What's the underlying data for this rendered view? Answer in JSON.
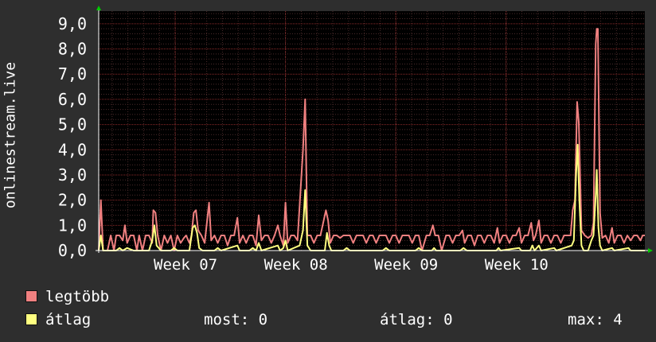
{
  "chart_data": {
    "type": "line",
    "ylabel": "onlinestream.live",
    "ylim": [
      0,
      9.5
    ],
    "yticks": [
      0,
      1,
      2,
      3,
      4,
      5,
      6,
      7,
      8,
      9
    ],
    "ytick_labels": [
      "0,0",
      "1,0",
      "2,0",
      "3,0",
      "4,0",
      "5,0",
      "6,0",
      "7,0",
      "8,0",
      "9,0"
    ],
    "xlim": [
      0,
      100
    ],
    "xticks": [
      {
        "x": 14,
        "label": "Week 07"
      },
      {
        "x": 34.2,
        "label": "Week 08"
      },
      {
        "x": 54.4,
        "label": "Week 09"
      },
      {
        "x": 74.6,
        "label": "Week 10"
      }
    ],
    "grid": true,
    "series": [
      {
        "name": "legtöbb",
        "color": "#f08080",
        "points": [
          [
            0,
            0
          ],
          [
            0.4,
            2.0
          ],
          [
            0.8,
            0
          ],
          [
            1.6,
            0
          ],
          [
            2.2,
            0.6
          ],
          [
            2.8,
            0
          ],
          [
            3.2,
            0.6
          ],
          [
            3.8,
            0.6
          ],
          [
            4.4,
            0.4
          ],
          [
            4.8,
            1.0
          ],
          [
            5.2,
            0.3
          ],
          [
            5.8,
            0.6
          ],
          [
            6.4,
            0.6
          ],
          [
            7.0,
            0
          ],
          [
            7.4,
            0.6
          ],
          [
            8.0,
            0
          ],
          [
            8.6,
            0.6
          ],
          [
            9.2,
            0.6
          ],
          [
            9.8,
            0.3
          ],
          [
            10.0,
            1.6
          ],
          [
            10.4,
            1.5
          ],
          [
            10.8,
            0.6
          ],
          [
            11.4,
            0
          ],
          [
            12.0,
            0.6
          ],
          [
            12.6,
            0.3
          ],
          [
            13.2,
            0.6
          ],
          [
            13.8,
            0
          ],
          [
            14.4,
            0.6
          ],
          [
            15.0,
            0.3
          ],
          [
            15.6,
            0.5
          ],
          [
            16.0,
            0.6
          ],
          [
            16.6,
            0.3
          ],
          [
            17.0,
            0.6
          ],
          [
            17.4,
            1.5
          ],
          [
            17.8,
            1.6
          ],
          [
            18.2,
            0.8
          ],
          [
            18.8,
            0.6
          ],
          [
            19.4,
            0.3
          ],
          [
            20.2,
            1.9
          ],
          [
            20.6,
            0.4
          ],
          [
            21.2,
            0.6
          ],
          [
            21.8,
            0.3
          ],
          [
            22.4,
            0.6
          ],
          [
            23.0,
            0.6
          ],
          [
            23.6,
            0.2
          ],
          [
            24.2,
            0.6
          ],
          [
            24.8,
            0.6
          ],
          [
            25.4,
            1.3
          ],
          [
            25.8,
            0.3
          ],
          [
            26.4,
            0.6
          ],
          [
            27.0,
            0.3
          ],
          [
            27.6,
            0.6
          ],
          [
            28.2,
            0.6
          ],
          [
            28.8,
            0.2
          ],
          [
            29.3,
            1.4
          ],
          [
            29.8,
            0.4
          ],
          [
            30.4,
            0.6
          ],
          [
            31.0,
            0.6
          ],
          [
            31.6,
            0.3
          ],
          [
            32.2,
            0.6
          ],
          [
            32.8,
            1.0
          ],
          [
            33.2,
            0.6
          ],
          [
            33.8,
            0.2
          ],
          [
            34.2,
            1.9
          ],
          [
            34.6,
            0.3
          ],
          [
            35.2,
            0.6
          ],
          [
            35.8,
            0.6
          ],
          [
            36.4,
            0.4
          ],
          [
            37.4,
            4.0
          ],
          [
            37.8,
            6.0
          ],
          [
            38.2,
            0.6
          ],
          [
            38.8,
            0.6
          ],
          [
            39.4,
            0.3
          ],
          [
            40.0,
            0.6
          ],
          [
            40.6,
            0.6
          ],
          [
            41.6,
            1.6
          ],
          [
            42.0,
            1.2
          ],
          [
            42.4,
            0.3
          ],
          [
            43.0,
            0.6
          ],
          [
            43.6,
            0.6
          ],
          [
            44.2,
            0.5
          ],
          [
            44.8,
            0.6
          ],
          [
            45.4,
            0.6
          ],
          [
            46.0,
            0.6
          ],
          [
            46.6,
            0.3
          ],
          [
            47.2,
            0.6
          ],
          [
            47.8,
            0.6
          ],
          [
            48.4,
            0.6
          ],
          [
            49.0,
            0.3
          ],
          [
            49.6,
            0.6
          ],
          [
            50.2,
            0.6
          ],
          [
            50.8,
            0.3
          ],
          [
            51.4,
            0.6
          ],
          [
            52.0,
            0.6
          ],
          [
            52.6,
            0.6
          ],
          [
            53.2,
            0.3
          ],
          [
            53.8,
            0.6
          ],
          [
            54.4,
            0.6
          ],
          [
            55.0,
            0.3
          ],
          [
            55.6,
            0.6
          ],
          [
            56.2,
            0.6
          ],
          [
            56.8,
            0.6
          ],
          [
            57.4,
            0.3
          ],
          [
            58.0,
            0.6
          ],
          [
            58.6,
            0.6
          ],
          [
            59.2,
            0
          ],
          [
            60.0,
            0.6
          ],
          [
            60.6,
            0.6
          ],
          [
            61.2,
            1.0
          ],
          [
            61.6,
            0.6
          ],
          [
            62.2,
            0.6
          ],
          [
            62.8,
            0
          ],
          [
            63.6,
            0.6
          ],
          [
            64.2,
            0.6
          ],
          [
            64.8,
            0.3
          ],
          [
            65.4,
            0.6
          ],
          [
            66.0,
            0.6
          ],
          [
            66.6,
            0.8
          ],
          [
            67.0,
            0.3
          ],
          [
            67.6,
            0.6
          ],
          [
            68.2,
            0.6
          ],
          [
            68.8,
            0.2
          ],
          [
            69.4,
            0.6
          ],
          [
            70.0,
            0.6
          ],
          [
            70.6,
            0.3
          ],
          [
            71.2,
            0.6
          ],
          [
            71.8,
            0.6
          ],
          [
            72.4,
            0.3
          ],
          [
            73.0,
            0.9
          ],
          [
            73.4,
            0.3
          ],
          [
            74.0,
            0.6
          ],
          [
            74.6,
            0.6
          ],
          [
            75.2,
            0.3
          ],
          [
            75.8,
            0.6
          ],
          [
            76.4,
            0.6
          ],
          [
            77.0,
            0.9
          ],
          [
            77.4,
            0.3
          ],
          [
            78.0,
            0.6
          ],
          [
            78.6,
            0.6
          ],
          [
            79.2,
            1.1
          ],
          [
            79.6,
            0.4
          ],
          [
            80.0,
            0.6
          ],
          [
            80.6,
            1.2
          ],
          [
            81.0,
            0.3
          ],
          [
            81.6,
            0.6
          ],
          [
            82.2,
            0.6
          ],
          [
            82.8,
            0.3
          ],
          [
            83.4,
            0.6
          ],
          [
            84.0,
            0.6
          ],
          [
            84.6,
            0.3
          ],
          [
            85.2,
            0.6
          ],
          [
            85.8,
            0.6
          ],
          [
            86.4,
            0.6
          ],
          [
            86.8,
            1.6
          ],
          [
            87.2,
            2.0
          ],
          [
            87.6,
            5.9
          ],
          [
            87.9,
            5.1
          ],
          [
            88.4,
            0.8
          ],
          [
            89.0,
            0.6
          ],
          [
            89.6,
            0.5
          ],
          [
            90.2,
            0.6
          ],
          [
            90.6,
            1.1
          ],
          [
            91.0,
            8.2
          ],
          [
            91.2,
            8.8
          ],
          [
            91.4,
            8.8
          ],
          [
            91.8,
            1.5
          ],
          [
            92.2,
            0.5
          ],
          [
            92.8,
            0.6
          ],
          [
            93.4,
            0.3
          ],
          [
            94.0,
            0.9
          ],
          [
            94.4,
            0.3
          ],
          [
            95.0,
            0.6
          ],
          [
            95.6,
            0.6
          ],
          [
            96.2,
            0.3
          ],
          [
            96.8,
            0.6
          ],
          [
            97.4,
            0.4
          ],
          [
            98.0,
            0.6
          ],
          [
            98.6,
            0.6
          ],
          [
            99.2,
            0.4
          ],
          [
            99.6,
            0.6
          ],
          [
            100,
            0.6
          ]
        ]
      },
      {
        "name": "átlag",
        "color": "#ffff80",
        "points": [
          [
            0,
            0
          ],
          [
            0.4,
            0.6
          ],
          [
            0.8,
            0
          ],
          [
            3.2,
            0
          ],
          [
            3.8,
            0.1
          ],
          [
            4.4,
            0
          ],
          [
            5.2,
            0.1
          ],
          [
            6.4,
            0
          ],
          [
            9.2,
            0
          ],
          [
            9.8,
            0.4
          ],
          [
            10.2,
            1.0
          ],
          [
            10.6,
            0.2
          ],
          [
            11.4,
            0
          ],
          [
            13.2,
            0
          ],
          [
            13.8,
            0.1
          ],
          [
            14.4,
            0
          ],
          [
            16.6,
            0
          ],
          [
            17.2,
            0.9
          ],
          [
            17.6,
            1.0
          ],
          [
            18.0,
            0.7
          ],
          [
            18.4,
            0.1
          ],
          [
            19.0,
            0
          ],
          [
            21.2,
            0
          ],
          [
            21.8,
            0.1
          ],
          [
            22.4,
            0
          ],
          [
            25.4,
            0.2
          ],
          [
            25.8,
            0
          ],
          [
            27.6,
            0
          ],
          [
            28.2,
            0.1
          ],
          [
            28.8,
            0
          ],
          [
            29.3,
            0.3
          ],
          [
            29.8,
            0
          ],
          [
            32.8,
            0.2
          ],
          [
            33.2,
            0
          ],
          [
            33.8,
            0.1
          ],
          [
            34.2,
            0.4
          ],
          [
            34.6,
            0
          ],
          [
            36.8,
            0.2
          ],
          [
            37.4,
            0.8
          ],
          [
            37.8,
            2.4
          ],
          [
            38.2,
            0.2
          ],
          [
            38.8,
            0
          ],
          [
            41.4,
            0
          ],
          [
            41.8,
            0.7
          ],
          [
            42.2,
            0.2
          ],
          [
            42.6,
            0
          ],
          [
            44.8,
            0
          ],
          [
            45.4,
            0.1
          ],
          [
            46.0,
            0
          ],
          [
            52.0,
            0
          ],
          [
            52.6,
            0.1
          ],
          [
            53.2,
            0
          ],
          [
            58.0,
            0
          ],
          [
            58.6,
            0.1
          ],
          [
            59.2,
            0
          ],
          [
            61.0,
            0
          ],
          [
            61.4,
            0.1
          ],
          [
            61.8,
            0
          ],
          [
            66.2,
            0
          ],
          [
            66.8,
            0.1
          ],
          [
            67.4,
            0
          ],
          [
            72.8,
            0
          ],
          [
            73.2,
            0.1
          ],
          [
            73.6,
            0
          ],
          [
            77.0,
            0.1
          ],
          [
            77.4,
            0
          ],
          [
            79.0,
            0
          ],
          [
            79.4,
            0.2
          ],
          [
            79.8,
            0
          ],
          [
            80.6,
            0.2
          ],
          [
            81.0,
            0
          ],
          [
            83.4,
            0.1
          ],
          [
            83.8,
            0
          ],
          [
            86.6,
            0.2
          ],
          [
            87.0,
            0.4
          ],
          [
            87.4,
            3.0
          ],
          [
            87.7,
            4.2
          ],
          [
            88.0,
            2.0
          ],
          [
            88.4,
            0.2
          ],
          [
            88.8,
            0
          ],
          [
            89.6,
            0
          ],
          [
            90.2,
            0.4
          ],
          [
            90.6,
            0.6
          ],
          [
            91.0,
            2.2
          ],
          [
            91.2,
            3.2
          ],
          [
            91.5,
            0.9
          ],
          [
            91.8,
            0.2
          ],
          [
            92.2,
            0
          ],
          [
            94.0,
            0.1
          ],
          [
            94.4,
            0
          ],
          [
            97.0,
            0.1
          ],
          [
            97.4,
            0
          ],
          [
            100,
            0
          ]
        ]
      }
    ],
    "legend": {
      "placement": "bottom-left",
      "items": [
        {
          "label": "legtöbb",
          "color": "#f08080"
        },
        {
          "label": "átlag",
          "color": "#ffff80"
        }
      ]
    }
  },
  "stats": {
    "most": "most: 0",
    "atlag": "átlag: 0",
    "max": "max: 4"
  }
}
